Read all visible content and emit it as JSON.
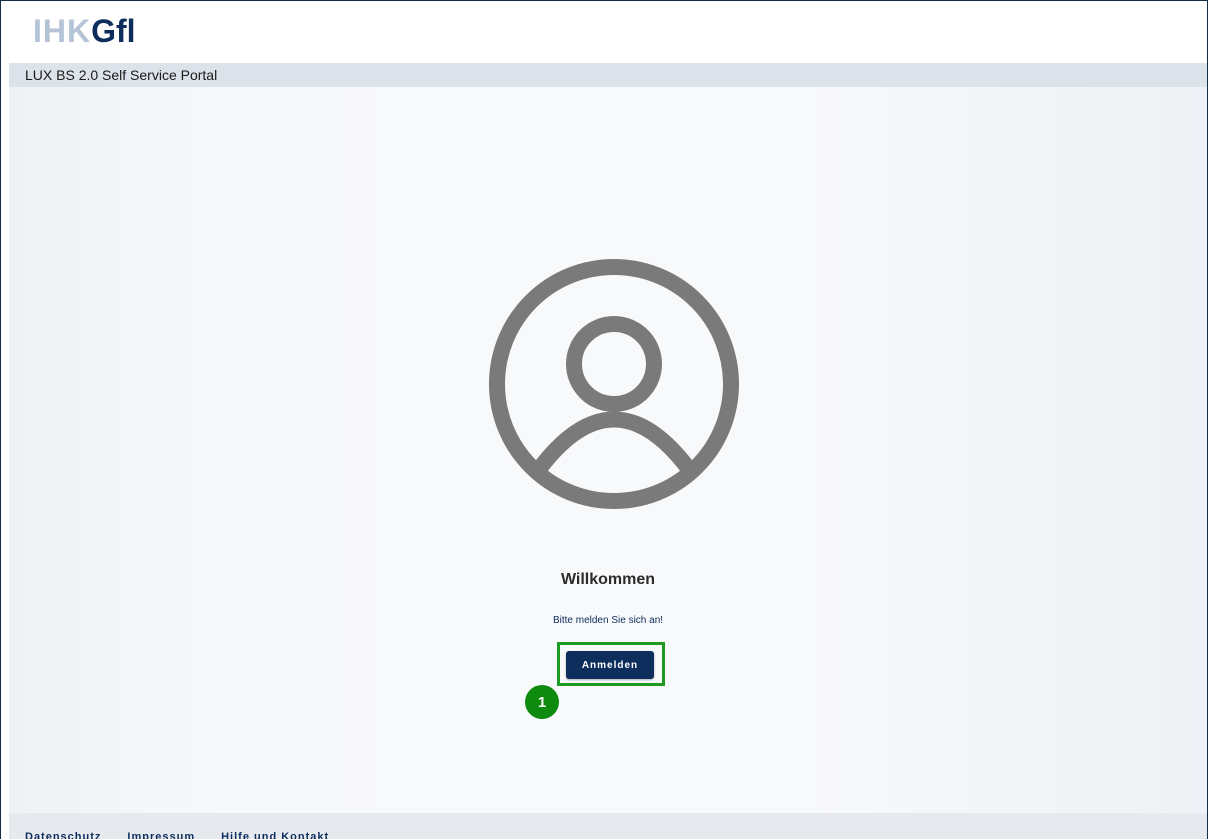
{
  "header": {
    "logo_left": "IHK",
    "logo_right": "Gfl"
  },
  "subbar": {
    "title": "LUX BS 2.0 Self Service Portal"
  },
  "main": {
    "avatar_icon": "user-circle-icon",
    "welcome_title": "Willkommen",
    "login_prompt": "Bitte melden Sie sich an!",
    "login_button_label": "Anmelden",
    "step_badge": "1"
  },
  "footer": {
    "links": [
      "Datenschutz",
      "Impressum",
      "Hilfe und Kontakt"
    ]
  },
  "colors": {
    "brand_navy": "#0d2e5c",
    "logo_light": "#b5c3d6",
    "highlight_green": "#1e9a1e",
    "avatar_gray": "#7a7a7a"
  }
}
